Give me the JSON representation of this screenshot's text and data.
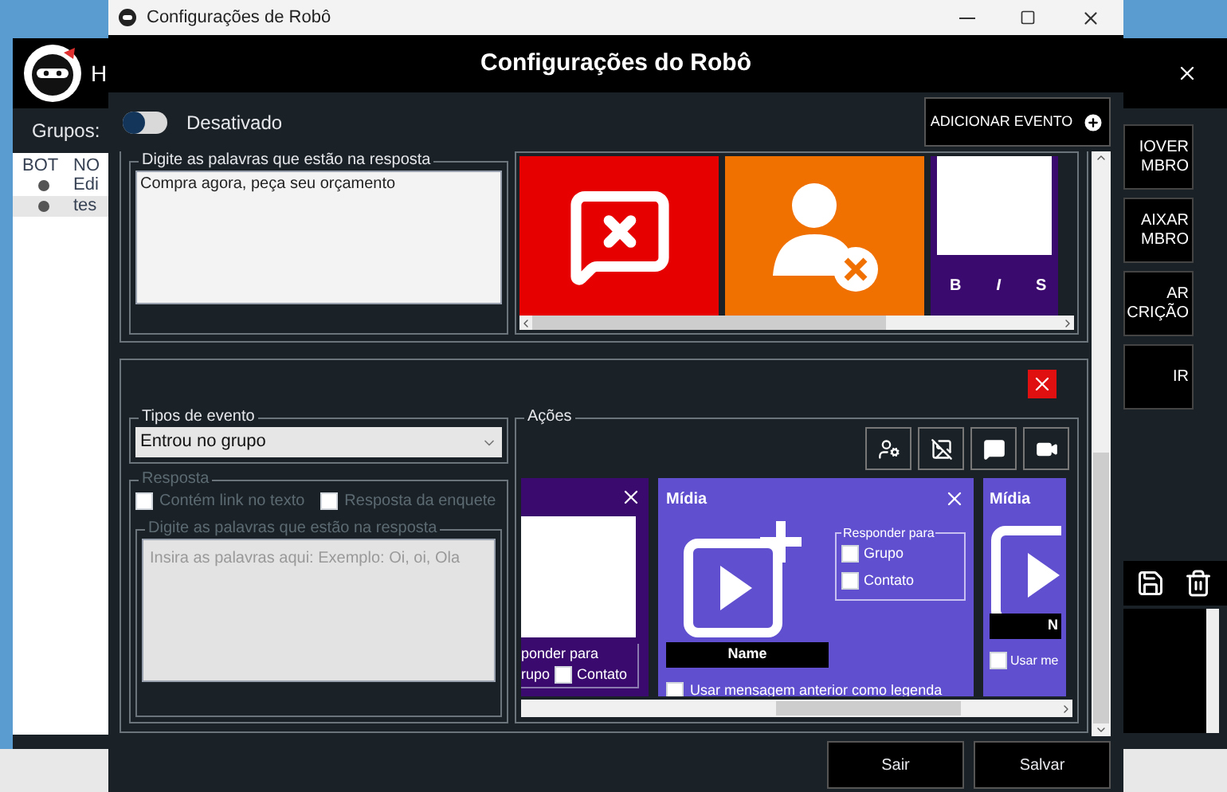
{
  "app": {
    "header_letter": "H",
    "groups_label": "Grupos:",
    "columns": [
      "BOT",
      "NO"
    ],
    "rows": [
      {
        "name": "Edi",
        "selected": false
      },
      {
        "name": "tes",
        "selected": true
      }
    ],
    "side_buttons": [
      {
        "lines": [
          "IOVER",
          "MBRO"
        ]
      },
      {
        "lines": [
          "AIXAR",
          "MBRO"
        ]
      },
      {
        "lines": [
          "AR",
          "CRIÇÃO"
        ]
      },
      {
        "lines": [
          "IR"
        ]
      }
    ]
  },
  "dialog": {
    "window_title": "Configurações de Robô",
    "heading": "Configurações do Robô",
    "toggle": {
      "on": false,
      "label": "Desativado"
    },
    "add_button": "ADICIONAR EVENTO",
    "event_1": {
      "words_label": "Digite as palavras que estão na resposta",
      "words_value": "Compra agora, peça seu orçamento",
      "tiles": [
        {
          "kind": "message-x"
        },
        {
          "kind": "user-x"
        },
        {
          "kind": "editor",
          "tools": [
            "B",
            "I",
            "S"
          ]
        }
      ]
    },
    "event_2": {
      "type_label": "Tipos de evento",
      "type_value": "Entrou no grupo",
      "response": {
        "label": "Resposta",
        "disabled": true,
        "checks": [
          {
            "label": "Contém link no texto",
            "checked": false
          },
          {
            "label": "Resposta da enquete",
            "checked": false
          }
        ],
        "words_label": "Digite as palavras que estão na resposta",
        "words_placeholder": "Insira as palavras aqui: Exemplo: Oi, oi, Ola"
      },
      "actions_label": "Ações",
      "tools": [
        {
          "kind": "user-gear"
        },
        {
          "kind": "image-off"
        },
        {
          "kind": "message"
        },
        {
          "kind": "video"
        }
      ],
      "left_card": {
        "reply_label": "ponder para",
        "group_text": "rupo",
        "contact": {
          "label": "Contato",
          "checked": false
        }
      },
      "media_card": {
        "title": "Mídia",
        "reply_label": "Responder para",
        "checks": [
          {
            "label": "Grupo",
            "checked": false
          },
          {
            "label": "Contato",
            "checked": false
          }
        ],
        "name": "Name",
        "caption": {
          "label": "Usar mensagem anterior como legenda",
          "checked": false
        }
      },
      "right_card": {
        "title": "Mídia",
        "name": "N",
        "caption": {
          "label": "Usar me",
          "checked": false
        }
      }
    },
    "footer_buttons": [
      "Sair",
      "Salvar"
    ]
  }
}
